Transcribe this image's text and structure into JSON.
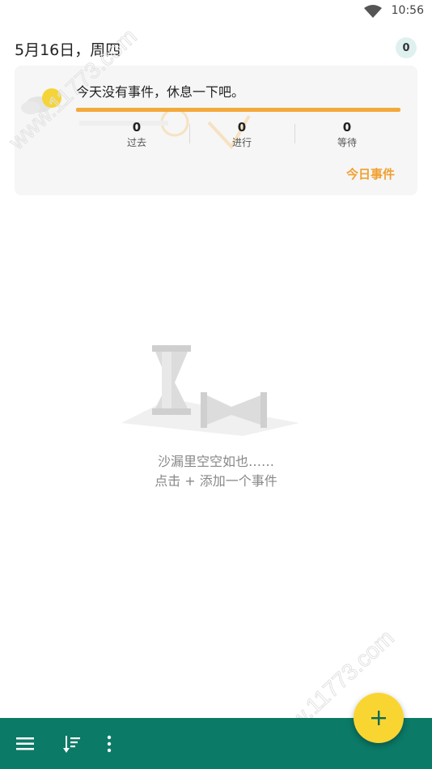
{
  "status_bar": {
    "time": "10:56",
    "wifi_icon": "wifi-icon"
  },
  "header": {
    "date": "5月16日，周四",
    "event_count": "0"
  },
  "summary": {
    "message": "今天没有事件，休息一下吧。",
    "progress_percent": 0,
    "stats": [
      {
        "value": "0",
        "label": "过去"
      },
      {
        "value": "0",
        "label": "进行"
      },
      {
        "value": "0",
        "label": "等待"
      }
    ],
    "link_label": "今日事件"
  },
  "empty_state": {
    "line1": "沙漏里空空如也……",
    "line2": "点击 + 添加一个事件",
    "icon": "hourglass-icon"
  },
  "watermarks": [
    "www.11773.com",
    "www.11773.com"
  ],
  "bottom_bar": {
    "icons": [
      "menu-icon",
      "sort-icon",
      "more-vert-icon"
    ]
  },
  "fab": {
    "icon": "plus-icon"
  },
  "colors": {
    "accent": "#f0a030",
    "progress": "#f2a93b",
    "bottom_bar": "#0b7a67",
    "fab": "#f9d532",
    "badge_bg": "#dff1ef"
  }
}
